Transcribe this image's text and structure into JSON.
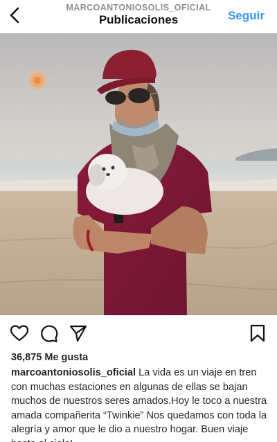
{
  "header": {
    "username": "MARCOANTONIOSOLIS_OFICIAL",
    "title": "Publicaciones",
    "follow_label": "Seguir",
    "back_icon": "chevron-left-icon"
  },
  "post": {
    "photo_description_icon": "post-photo",
    "actions": {
      "like_icon": "heart-icon",
      "comment_icon": "comment-icon",
      "share_icon": "send-icon",
      "save_icon": "bookmark-icon"
    },
    "likes_text": "36,875 Me gusta",
    "caption_user": "marcoantoniosolis_oficial",
    "caption_text": "La vida es un viaje en tren con muchas estaciones en algunas de ellas se bajan muchos de nuestros seres amados.Hoy le toco a nuestra amada compañerita “Twinkie” Nos quedamos con toda la alegría y amor que le dio a nuestro hogar. Buen viaje hasta el cielo!"
  },
  "colors": {
    "link_blue": "#3897f0",
    "text_dark": "#262626",
    "muted": "#8e8e8e"
  }
}
